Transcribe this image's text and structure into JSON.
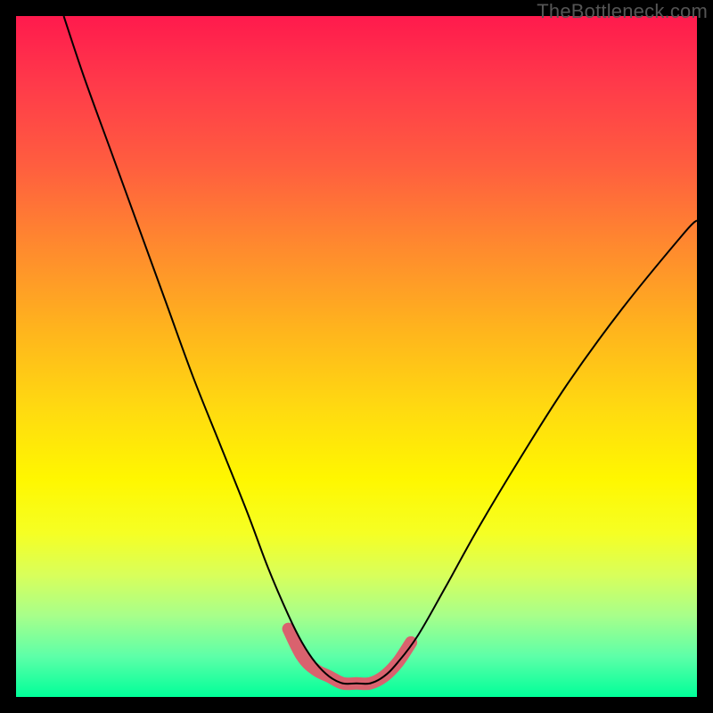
{
  "watermark": "TheBottleneck.com",
  "chart_data": {
    "type": "line",
    "title": "",
    "xlabel": "",
    "ylabel": "",
    "xlim": [
      0,
      100
    ],
    "ylim": [
      0,
      100
    ],
    "grid": false,
    "legend": false,
    "background_gradient": {
      "top_color": "#ff1a4d",
      "bottom_color": "#00ff99",
      "direction": "vertical"
    },
    "series": [
      {
        "name": "bottleneck-curve",
        "color": "#000000",
        "x": [
          7,
          10,
          14,
          18,
          22,
          26,
          30,
          34,
          37,
          40,
          42,
          44,
          46,
          48,
          50,
          52,
          54,
          56,
          59,
          63,
          68,
          74,
          81,
          89,
          98,
          100
        ],
        "y": [
          100,
          91,
          80,
          69,
          58,
          47,
          37,
          27,
          19,
          12,
          8,
          5,
          3,
          2,
          2,
          2,
          3,
          5,
          9,
          16,
          25,
          35,
          46,
          57,
          68,
          70
        ]
      },
      {
        "name": "optimal-zone-highlight",
        "color": "#d9626e",
        "x": [
          40,
          42,
          44,
          46,
          48,
          50,
          52,
          54,
          56,
          58
        ],
        "y": [
          10,
          6,
          4,
          3,
          2,
          2,
          2,
          3,
          5,
          8
        ]
      }
    ],
    "annotations": []
  }
}
